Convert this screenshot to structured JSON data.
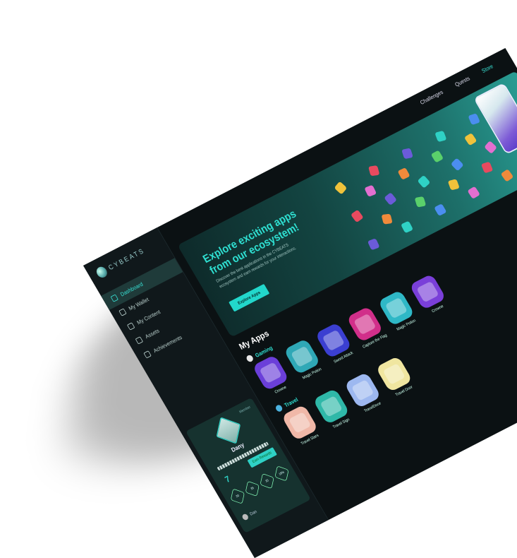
{
  "sidebar": {
    "logo": "CYBEATS",
    "nav": [
      {
        "label": "Dashboard",
        "icon": "grid-icon",
        "active": true
      },
      {
        "label": "My Wallet",
        "icon": "wallet-icon"
      },
      {
        "label": "My Content",
        "icon": "content-icon"
      },
      {
        "label": "Assets",
        "icon": "assets-icon"
      },
      {
        "label": "Achievements",
        "icon": "trophy-icon"
      }
    ]
  },
  "profile": {
    "name": "Dany",
    "status": "Member",
    "level": "7",
    "earn_button": "Earn Rewards",
    "stats": [
      "20",
      "35",
      "35",
      "18%"
    ],
    "user": "Dan"
  },
  "topnav": {
    "challenges": "Challenges",
    "quests": "Quests",
    "store": "Store"
  },
  "hero": {
    "title": "Explore exciting apps from our ecosystem!",
    "description": "Discover the best applications in the CYBEATS ecosystem and earn rewards for your interactions.",
    "button": "Explore Apps"
  },
  "myapps": {
    "title": "My Apps",
    "gaming_label": "Gaming",
    "travel_label": "Travel",
    "gaming": [
      {
        "label": "Crowne",
        "color": "#6b3fd9"
      },
      {
        "label": "Magic Potion",
        "color": "#2fa8b6"
      },
      {
        "label": "Sword Attack",
        "color": "#3b3fd1"
      },
      {
        "label": "Capture the Flag",
        "color": "#d12f8a"
      },
      {
        "label": "Magic Potion",
        "color": "#2fb8c6"
      },
      {
        "label": "Crowne",
        "color": "#7a3fd9"
      }
    ],
    "travel": [
      {
        "label": "Travel Stars",
        "color": "#f0b8a8"
      },
      {
        "label": "Travel Sign",
        "color": "#2fb8a8"
      },
      {
        "label": "TravelDoce",
        "color": "#9db8f0"
      },
      {
        "label": "Travel Door",
        "color": "#f0e6a0"
      }
    ]
  },
  "colors": {
    "accent": "#2fe0d2",
    "background": "#0b1113",
    "sidebar": "#10181b"
  }
}
